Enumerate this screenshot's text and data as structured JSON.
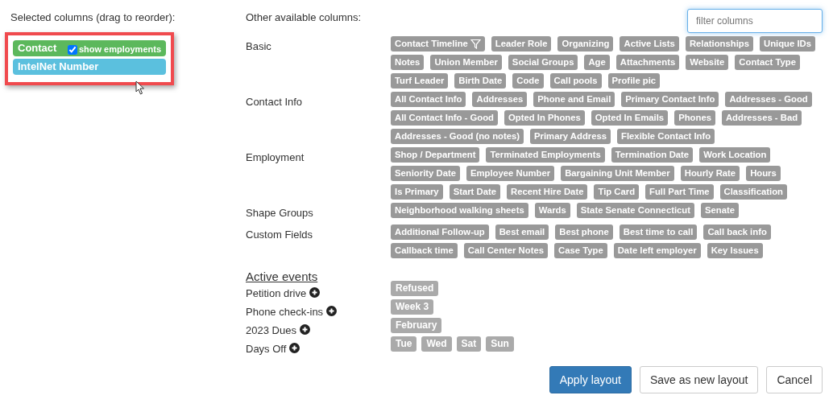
{
  "selected_panel": {
    "title": "Selected columns (drag to reorder):",
    "highlighted": true,
    "cursor": true,
    "items": [
      {
        "label": "Contact",
        "color": "#5cb85c",
        "option": {
          "label": "show employments",
          "checked": true
        }
      },
      {
        "label": "IntelNet Number",
        "color": "#5bc0de"
      }
    ]
  },
  "available_panel": {
    "title": "Other available columns:",
    "filter": {
      "placeholder": "filter columns"
    },
    "groups": [
      {
        "label": "Basic",
        "chips": [
          {
            "label": "Contact Timeline",
            "filter": true
          },
          {
            "label": "Leader Role",
            "filter": false
          },
          {
            "label": "Organizing",
            "filter": false
          },
          {
            "label": "Active Lists",
            "filter": false
          },
          {
            "label": "Relationships",
            "filter": false
          },
          {
            "label": "Unique IDs",
            "filter": false
          },
          {
            "label": "Notes",
            "filter": false
          },
          {
            "label": "Union Member",
            "filter": false
          },
          {
            "label": "Social Groups",
            "filter": false
          },
          {
            "label": "Age",
            "filter": false
          },
          {
            "label": "Attachments",
            "filter": false
          },
          {
            "label": "Website",
            "filter": false
          },
          {
            "label": "Contact Type",
            "filter": false
          },
          {
            "label": "Turf Leader",
            "filter": false
          },
          {
            "label": "Birth Date",
            "filter": false
          },
          {
            "label": "Code",
            "filter": false
          },
          {
            "label": "Call pools",
            "filter": false
          },
          {
            "label": "Profile pic",
            "filter": false
          }
        ]
      },
      {
        "label": "Contact Info",
        "chips": [
          {
            "label": "All Contact Info",
            "filter": false
          },
          {
            "label": "Addresses",
            "filter": false
          },
          {
            "label": "Phone and Email",
            "filter": false
          },
          {
            "label": "Primary Contact Info",
            "filter": false
          },
          {
            "label": "Addresses - Good",
            "filter": false
          },
          {
            "label": "All Contact Info - Good",
            "filter": false
          },
          {
            "label": "Opted In Phones",
            "filter": false
          },
          {
            "label": "Opted In Emails",
            "filter": false
          },
          {
            "label": "Phones",
            "filter": false
          },
          {
            "label": "Addresses - Bad",
            "filter": false
          },
          {
            "label": "Addresses - Good (no notes)",
            "filter": false
          },
          {
            "label": "Primary Address",
            "filter": false
          },
          {
            "label": "Flexible Contact Info",
            "filter": false
          }
        ]
      },
      {
        "label": "Employment",
        "chips": [
          {
            "label": "Shop / Department",
            "filter": false
          },
          {
            "label": "Terminated Employments",
            "filter": false
          },
          {
            "label": "Termination Date",
            "filter": false
          },
          {
            "label": "Work Location",
            "filter": false
          },
          {
            "label": "Seniority Date",
            "filter": false
          },
          {
            "label": "Employee Number",
            "filter": false
          },
          {
            "label": "Bargaining Unit Member",
            "filter": false
          },
          {
            "label": "Hourly Rate",
            "filter": false
          },
          {
            "label": "Hours",
            "filter": false
          },
          {
            "label": "Is Primary",
            "filter": false
          },
          {
            "label": "Start Date",
            "filter": false
          },
          {
            "label": "Recent Hire Date",
            "filter": false
          },
          {
            "label": "Tip Card",
            "filter": false
          },
          {
            "label": "Full Part Time",
            "filter": false
          },
          {
            "label": "Classification",
            "filter": false
          }
        ]
      },
      {
        "label": "Shape Groups",
        "chips": [
          {
            "label": "Neighborhood walking sheets",
            "filter": false
          },
          {
            "label": "Wards",
            "filter": false
          },
          {
            "label": "State Senate Connecticut",
            "filter": false
          },
          {
            "label": "Senate",
            "filter": false
          }
        ]
      },
      {
        "label": "Custom Fields",
        "chips": [
          {
            "label": "Additional Follow-up",
            "filter": false
          },
          {
            "label": "Best email",
            "filter": false
          },
          {
            "label": "Best phone",
            "filter": false
          },
          {
            "label": "Best time to call",
            "filter": false
          },
          {
            "label": "Call back info",
            "filter": false
          },
          {
            "label": "Callback time",
            "filter": false
          },
          {
            "label": "Call Center Notes",
            "filter": false
          },
          {
            "label": "Case Type",
            "filter": false
          },
          {
            "label": "Date left employer",
            "filter": false
          },
          {
            "label": "Key Issues",
            "filter": false
          }
        ]
      }
    ],
    "events_title": "Active events",
    "events": [
      {
        "label": "Petition drive",
        "chips": [
          "Refused"
        ]
      },
      {
        "label": "Phone check-ins",
        "chips": [
          "Week 3"
        ]
      },
      {
        "label": "2023 Dues",
        "chips": [
          "February"
        ]
      },
      {
        "label": "Days Off",
        "chips": [
          "Tue",
          "Wed",
          "Sat",
          "Sun"
        ]
      }
    ]
  },
  "buttons": [
    {
      "label": "Apply layout",
      "primary": true
    },
    {
      "label": "Save as new layout",
      "primary": false
    },
    {
      "label": "Cancel",
      "primary": false
    }
  ]
}
